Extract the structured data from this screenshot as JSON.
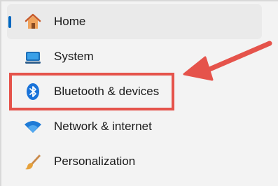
{
  "nav": {
    "items": [
      {
        "label": "Home",
        "icon": "home-icon",
        "selected": true
      },
      {
        "label": "System",
        "icon": "system-display-icon",
        "selected": false
      },
      {
        "label": "Bluetooth & devices",
        "icon": "bluetooth-icon",
        "selected": false
      },
      {
        "label": "Network & internet",
        "icon": "wifi-icon",
        "selected": false
      },
      {
        "label": "Personalization",
        "icon": "brush-icon",
        "selected": false
      }
    ]
  },
  "colors": {
    "accent": "#0067c0",
    "annotation": "#e5534b"
  }
}
